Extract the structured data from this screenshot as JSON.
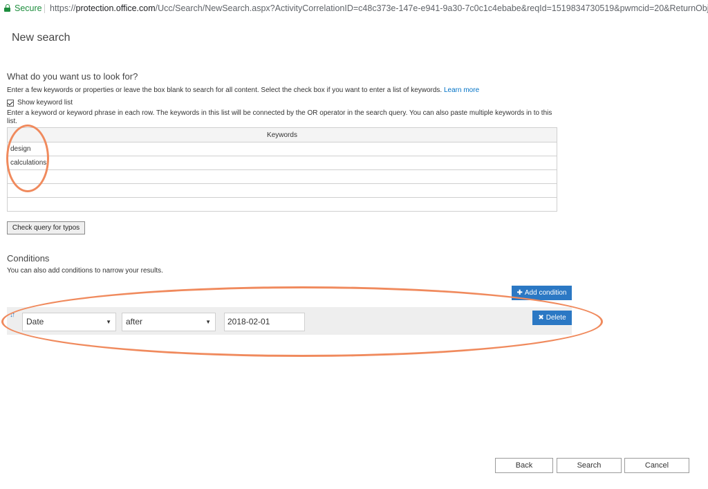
{
  "browser": {
    "secure_label": "Secure",
    "url_scheme": "https://",
    "url_host": "protection.office.com",
    "url_path": "/Ucc/Search/NewSearch.aspx?ActivityCorrelationID=c48c373e-147e-e941-9a30-7c0c1c4ebabe&reqId=1519834730519&pwmcid=20&ReturnObjectTy..."
  },
  "page": {
    "title": "New search"
  },
  "query_section": {
    "heading": "What do you want us to look for?",
    "description": "Enter a few keywords or properties or leave the box blank to search for all content. Select the check box if you want to enter a list of keywords.",
    "learn_more": "Learn more",
    "show_keyword_list_label": "Show keyword list",
    "show_keyword_list_checked": true,
    "keyword_help_line1": "Enter a keyword or keyword phrase in each row. The keywords in this list will be connected by the OR operator in the search query. You can also paste multiple keywords in to this",
    "keyword_help_line2": "list."
  },
  "keywords_table": {
    "header": "Keywords",
    "rows": [
      "design",
      "calculations",
      "",
      "",
      ""
    ]
  },
  "check_typos_label": "Check query for typos",
  "conditions": {
    "heading": "Conditions",
    "description": "You can also add conditions to narrow your results.",
    "add_condition_label": "Add condition",
    "row": {
      "property": "Date",
      "operator": "after",
      "value": "2018-02-01",
      "delete_label": "Delete"
    }
  },
  "footer": {
    "back_label": "Back",
    "search_label": "Search",
    "cancel_label": "Cancel"
  },
  "icons": {
    "plus": "plus-icon",
    "times": "close-icon",
    "sort": "sort-icon",
    "caret": "caret-down-icon",
    "lock": "lock-icon"
  },
  "colors": {
    "accent": "#2b78c4",
    "secure_green": "#1e8e3e",
    "annotation_orange": "#f08a5d",
    "link": "#0072c6"
  }
}
